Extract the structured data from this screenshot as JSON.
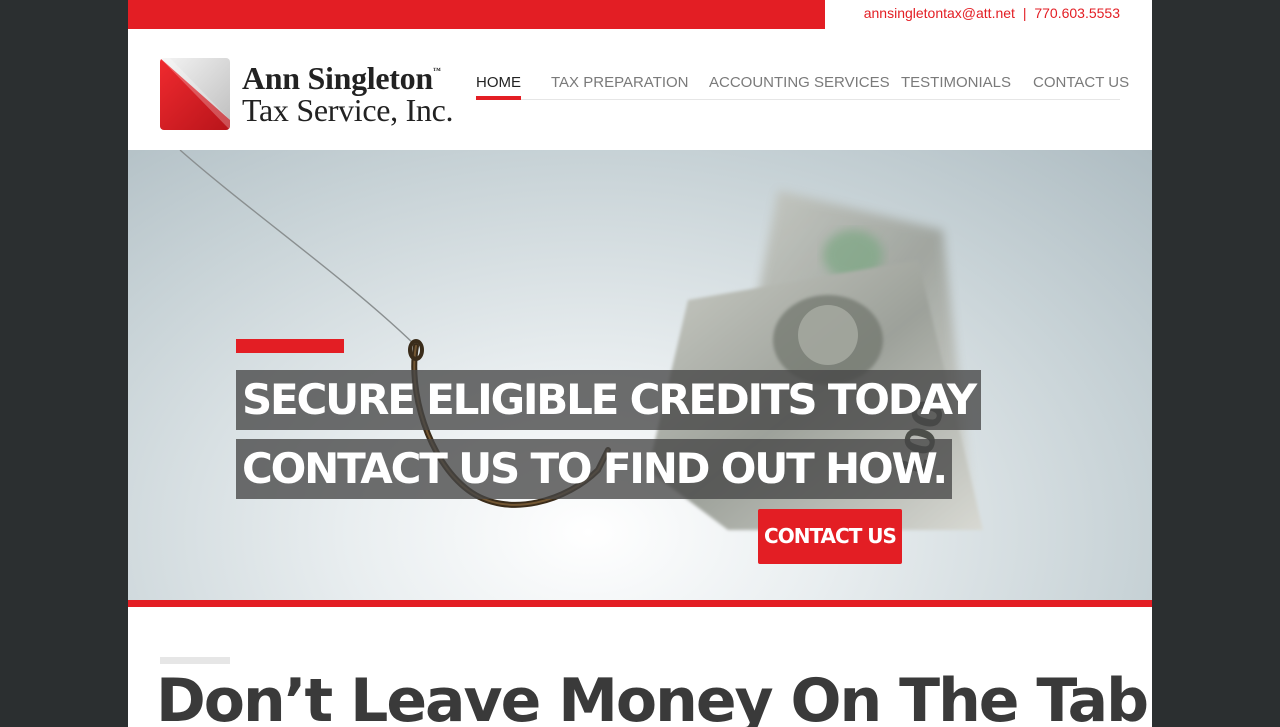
{
  "topbar": {
    "email": "annsingletontax@att.net",
    "separator": "|",
    "phone": "770.603.5553"
  },
  "logo": {
    "line1": "Ann Singleton",
    "trademark": "™",
    "line2": "Tax Service, Inc."
  },
  "nav": {
    "items": [
      {
        "label": "HOME",
        "active": true
      },
      {
        "label": "TAX PREPARATION",
        "active": false
      },
      {
        "label": "ACCOUNTING SERVICES",
        "active": false
      },
      {
        "label": "TESTIMONIALS",
        "active": false
      },
      {
        "label": "CONTACT US",
        "active": false
      }
    ]
  },
  "hero": {
    "line1": "SECURE ELIGIBLE CREDITS TODAY",
    "line2": "CONTACT US TO FIND OUT HOW.",
    "button_label": "CONTACT US",
    "image_icon": "fishhook-dollar-bill-image"
  },
  "content": {
    "heading": "Don’t Leave Money On The Table."
  },
  "colors": {
    "accent": "#e31e24",
    "background": "#2b2f30",
    "text_dark": "#222222",
    "nav_text": "#7a7a7a"
  }
}
